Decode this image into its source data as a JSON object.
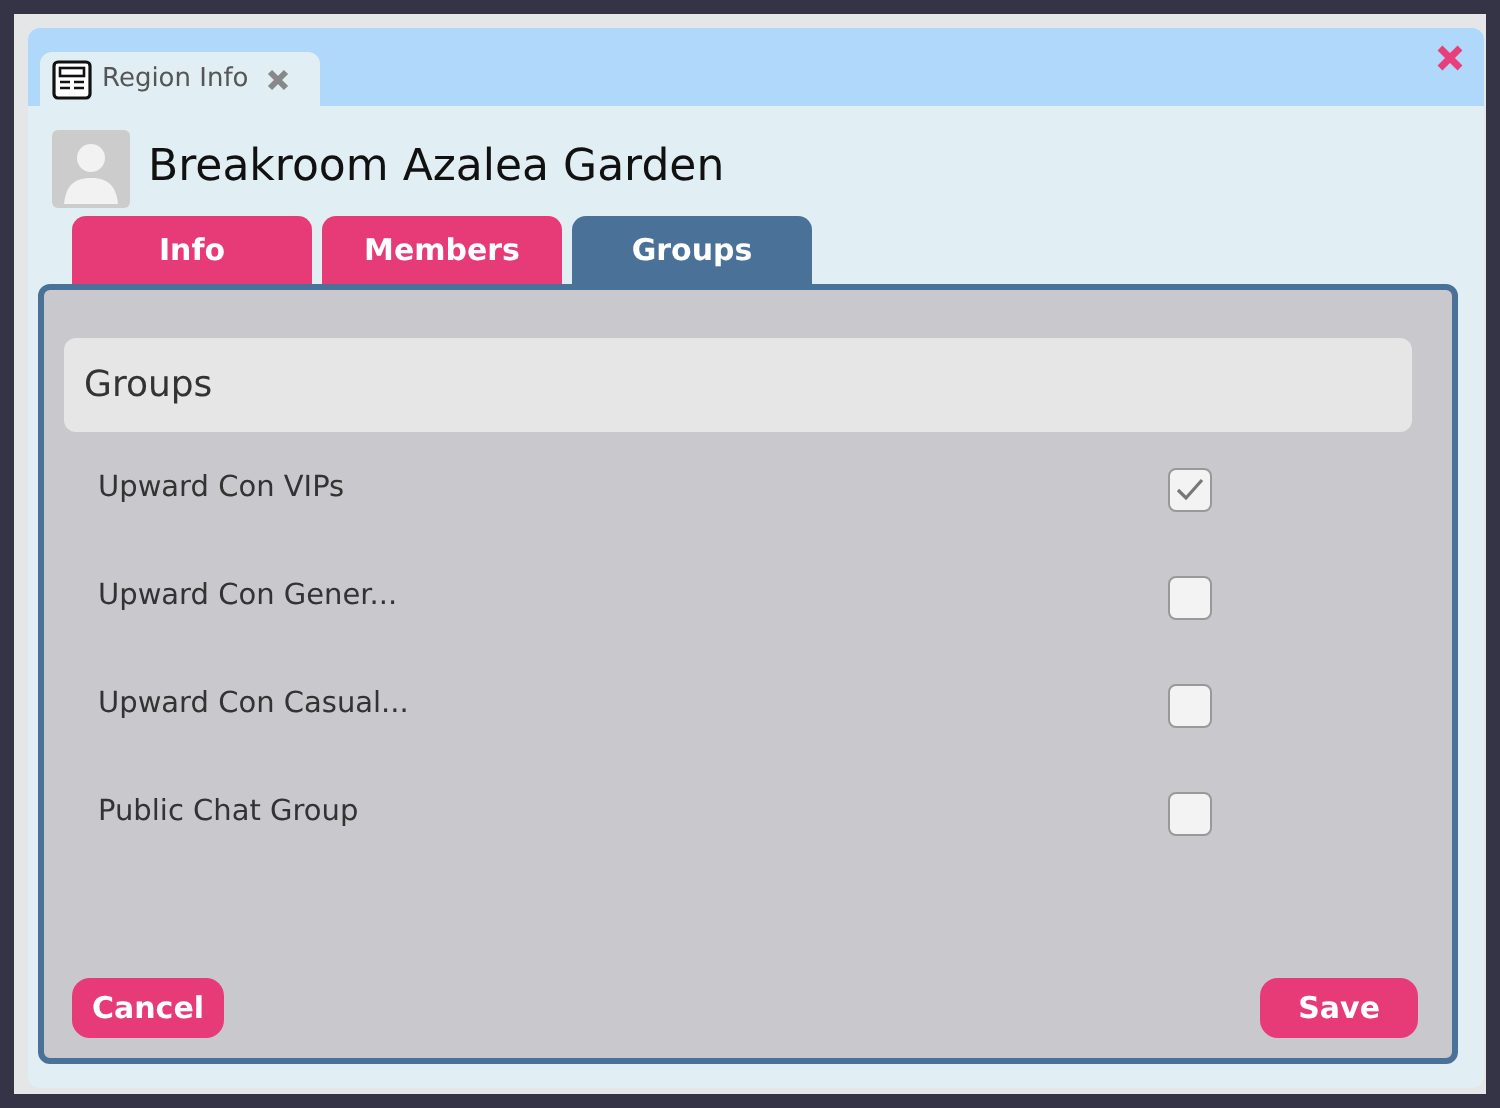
{
  "window": {
    "tab_title": "Region Info"
  },
  "region": {
    "name": "Breakroom Azalea Garden"
  },
  "tabs": [
    {
      "label": "Info",
      "selected": false
    },
    {
      "label": "Members",
      "selected": false
    },
    {
      "label": "Groups",
      "selected": true
    }
  ],
  "groups": {
    "heading": "Groups",
    "items": [
      {
        "name": "Upward Con VIPs",
        "checked": true
      },
      {
        "name": "Upward Con Gener...",
        "checked": false
      },
      {
        "name": "Upward Con Casual...",
        "checked": false
      },
      {
        "name": "Public Chat Group",
        "checked": false
      }
    ]
  },
  "buttons": {
    "cancel": "Cancel",
    "save": "Save"
  }
}
